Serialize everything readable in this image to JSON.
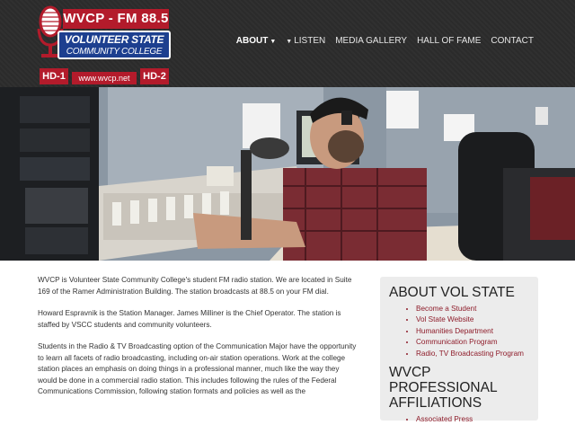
{
  "logo": {
    "call_sign": "WVCP - FM 88.5",
    "school_line1": "VOLUNTEER STATE",
    "school_line2": "COMMUNITY COLLEGE",
    "hd1": "HD-1",
    "hd2": "HD-2",
    "url": "www.wvcp.net"
  },
  "nav": {
    "about": "ABOUT",
    "listen": "LISTEN",
    "media": "MEDIA GALLERY",
    "hall": "HALL OF FAME",
    "contact": "CONTACT"
  },
  "main": {
    "p1": "WVCP is Volunteer State Community College's student FM radio station. We are located in Suite 169 of the Ramer Administration Building. The station broadcasts at 88.5 on your FM dial.",
    "p2": "Howard Espravnik is the Station Manager. James Milliner is the Chief Operator. The station is staffed by VSCC students and community volunteers.",
    "p3": "Students in the Radio & TV Broadcasting option of the Communication Major have the opportunity to learn all facets of radio broadcasting, including on-air station operations. Work at the college station places an emphasis on doing things in a professional manner, much like the way they would be done in a commercial radio station. This includes following the rules of the Federal Communications Commission, following station formats and policies as well as the"
  },
  "sidebar": {
    "about_title": "ABOUT VOL STATE",
    "about_links": [
      "Become a Student",
      "Vol State Website",
      "Humanities Department",
      "Communication Program",
      "Radio, TV Broadcasting Program"
    ],
    "affil_title": "WVCP PROFESSIONAL AFFILIATIONS",
    "affil_links": [
      "Associated Press"
    ]
  },
  "colors": {
    "header_bg": "#2b2b2b",
    "link": "#8e1c2a",
    "logo_red": "#b31b2b",
    "logo_blue": "#1d3f8f"
  }
}
